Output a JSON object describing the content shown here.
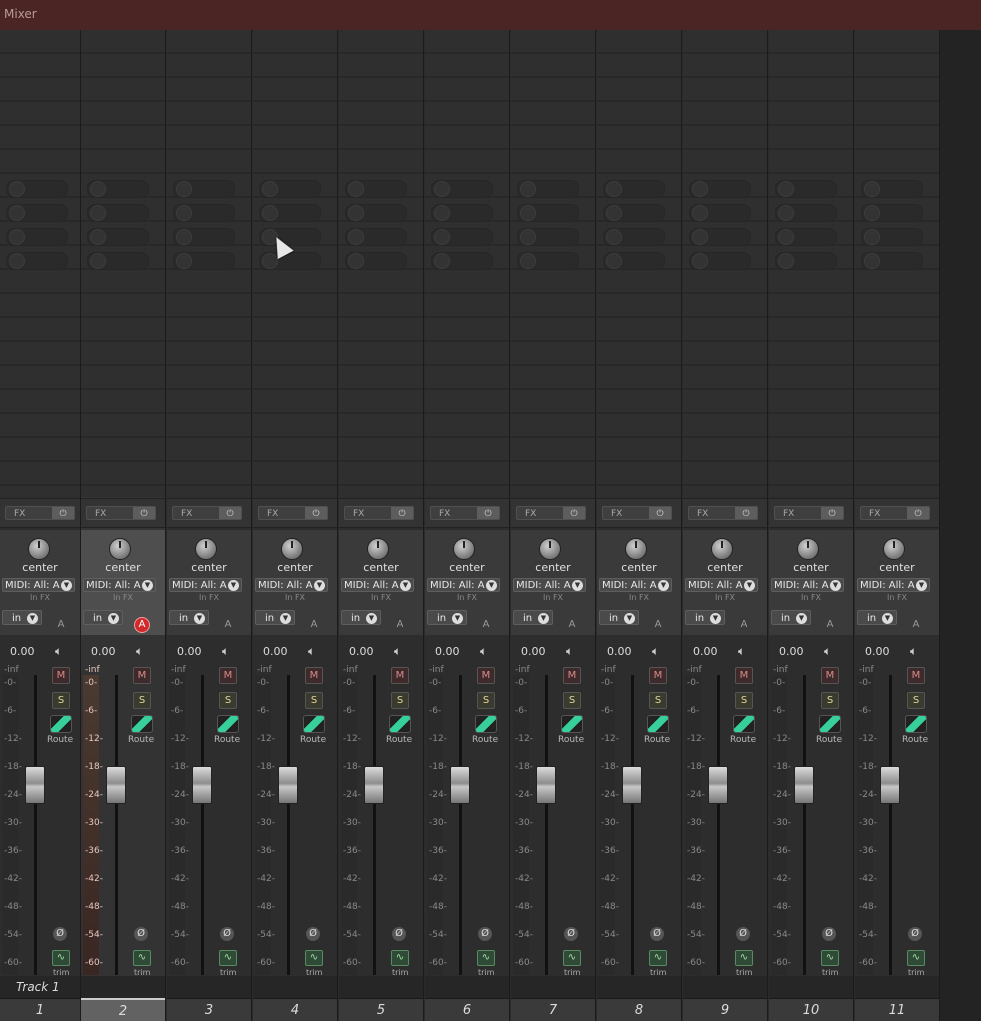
{
  "window": {
    "title": "Mixer"
  },
  "fx_button": {
    "label": "FX",
    "power_icon": "power-icon"
  },
  "panel": {
    "pan_label": "center",
    "midi_input": "MIDI: All: A",
    "in_fx_label": "In FX",
    "input_monitor_label": "in",
    "automation_label": "A"
  },
  "controls": {
    "volume": "0.00",
    "mute_label": "M",
    "solo_label": "S",
    "route_label": "Route",
    "phase_label": "Ø",
    "trim_label": "trim",
    "meter_scale": [
      "-inf",
      "-0-",
      "-6-",
      "-12-",
      "-18-",
      "-24-",
      "-30-",
      "-36-",
      "-42-",
      "-48-",
      "-54-",
      "-60-"
    ]
  },
  "selected_track_name": "Track 1",
  "selected_index": 2,
  "armed_index": 2,
  "tracks": [
    {
      "number": "1"
    },
    {
      "number": "2"
    },
    {
      "number": "3"
    },
    {
      "number": "4"
    },
    {
      "number": "5"
    },
    {
      "number": "6"
    },
    {
      "number": "7"
    },
    {
      "number": "8"
    },
    {
      "number": "9"
    },
    {
      "number": "10"
    },
    {
      "number": "11"
    }
  ],
  "colors": {
    "titlebar": "#4a2524",
    "armed": "#d22a2a",
    "route_accent": "#38d09a"
  }
}
